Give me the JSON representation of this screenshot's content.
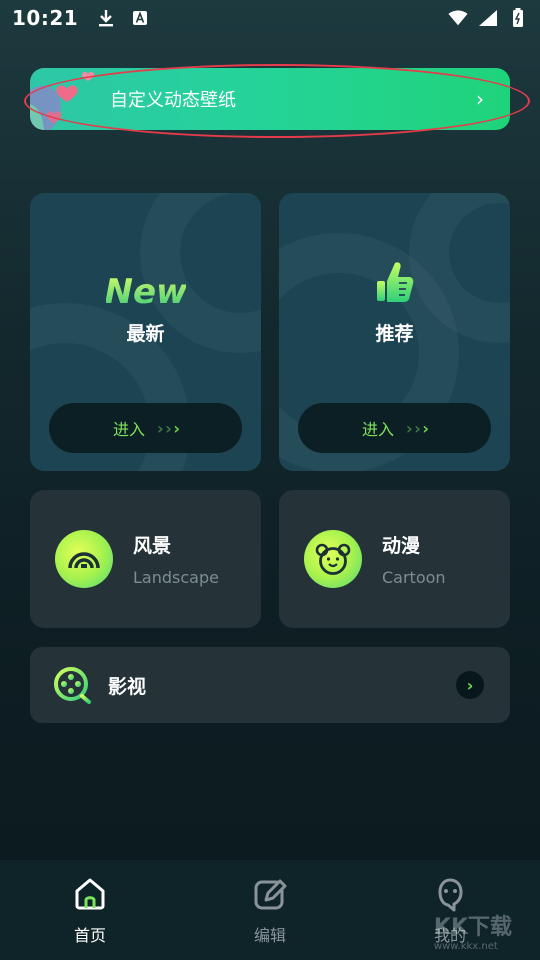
{
  "status_bar": {
    "time": "10:21",
    "icons_left": [
      "download-icon",
      "text-a-icon"
    ],
    "icons_right": [
      "wifi-icon",
      "signal-icon",
      "battery-icon"
    ]
  },
  "banner": {
    "title": "自定义动态壁纸",
    "chevron": "›",
    "colors": {
      "start": "#2ec7a6",
      "end": "#1fd37a",
      "highlight_ring": "#e53b4a"
    }
  },
  "features": [
    {
      "label": "最新",
      "icon": "new-badge-icon",
      "icon_text": "New",
      "button_label": "进入"
    },
    {
      "label": "推荐",
      "icon": "thumbs-up-icon",
      "button_label": "进入"
    }
  ],
  "categories": [
    {
      "title": "风景",
      "subtitle": "Landscape",
      "icon": "landscape-icon"
    },
    {
      "title": "动漫",
      "subtitle": "Cartoon",
      "icon": "bear-face-icon"
    }
  ],
  "movie": {
    "title": "影视",
    "icon": "film-reel-icon",
    "chevron": "›"
  },
  "bottom_nav": [
    {
      "label": "首页",
      "icon": "home-icon",
      "active": true
    },
    {
      "label": "编辑",
      "icon": "edit-icon",
      "active": false
    },
    {
      "label": "我的",
      "icon": "profile-icon",
      "active": false
    }
  ],
  "watermark": {
    "text": "KK下载",
    "url_text": "www.kkx.net"
  },
  "colors": {
    "accent_green": "#7ee35c",
    "card_bg": "#1c4452",
    "tile_bg": "#253338"
  }
}
